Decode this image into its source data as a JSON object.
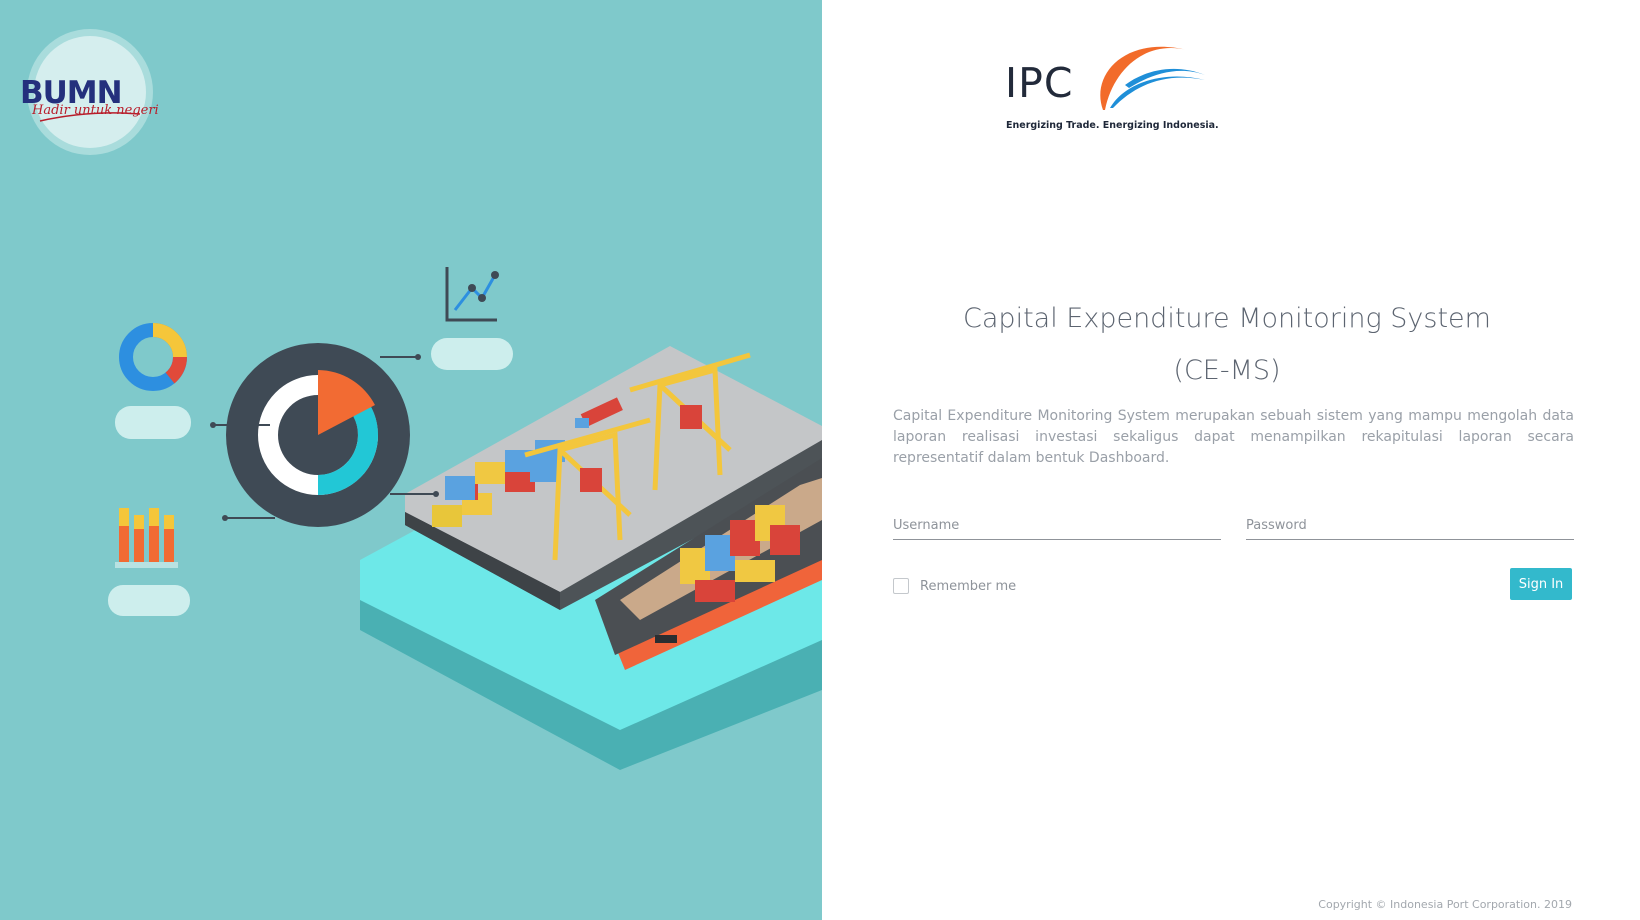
{
  "brand": {
    "bumn_logo_text": "BUMN",
    "bumn_tagline": "Hadir untuk negeri",
    "ipc_wordmark": "IPC",
    "ipc_tagline": "Energizing Trade. Energizing Indonesia."
  },
  "login": {
    "title_line1": "Capital Expenditure Monitoring System",
    "title_line2": "(CE-MS)",
    "description": "Capital Expenditure Monitoring System merupakan sebuah sistem yang mampu mengolah data laporan realisasi investasi sekaligus dapat menampilkan rekapitulasi laporan secara representatif dalam bentuk Dashboard.",
    "username_placeholder": "Username",
    "password_placeholder": "Password",
    "remember_label": "Remember me",
    "signin_label": "Sign In"
  },
  "footer": {
    "copyright": "Copyright © Indonesia Port Corporation. 2019"
  },
  "colors": {
    "left_panel_bg": "#7fc9cb",
    "accent": "#33b9cc",
    "title_text": "#5c6470",
    "ipc_orange": "#f26b2a",
    "ipc_blue": "#1f8fd8"
  },
  "icons": [
    "bumn-logo",
    "ipc-logo",
    "donut-chart-icon",
    "pie-chart-icon",
    "bar-chart-icon",
    "line-chart-icon",
    "port-illustration"
  ]
}
